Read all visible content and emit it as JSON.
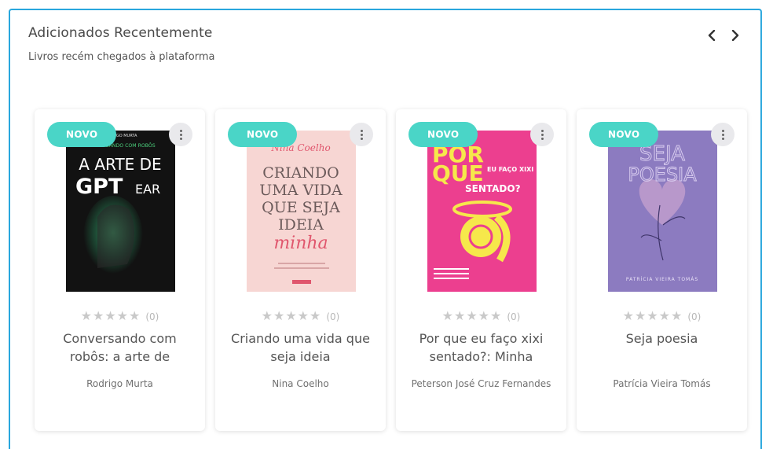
{
  "section": {
    "title": "Adicionados Recentemente",
    "subtitle": "Livros recém chegados à plataforma",
    "prev_icon": "chevron-left-icon",
    "next_icon": "chevron-right-icon"
  },
  "colors": {
    "accent_border": "#29a7dd",
    "badge": "#4ad5c7"
  },
  "books": [
    {
      "badge": "NOVO",
      "stars": "★★★★★",
      "rating_count": "(0)",
      "title": "Conversando com robôs: a arte de",
      "author": "Rodrigo Murta",
      "cover": {
        "top_text": "CONVERSANDO COM ROBÔS",
        "line1": "A ARTE DE",
        "line2": "GPT",
        "line3": "EAR",
        "author_line": "RODRIGO MURTA"
      }
    },
    {
      "badge": "NOVO",
      "stars": "★★★★★",
      "rating_count": "(0)",
      "title": "Criando uma vida que seja ideia",
      "author": "Nina Coelho",
      "cover": {
        "author_line": "Nina Coelho",
        "line1": "CRIANDO",
        "line2": "UMA VIDA",
        "line3": "QUE SEJA",
        "line4": "IDEIA",
        "line5": "minha"
      }
    },
    {
      "badge": "NOVO",
      "stars": "★★★★★",
      "rating_count": "(0)",
      "title": "Por que eu faço xixi sentado?: Minha",
      "author": "Peterson José Cruz Fernandes",
      "cover": {
        "line1": "POR",
        "line2": "QUE",
        "line3": "EU FAÇO XIXI",
        "line4": "SENTADO?"
      }
    },
    {
      "badge": "NOVO",
      "stars": "★★★★★",
      "rating_count": "(0)",
      "title": "Seja poesia",
      "author": "Patrícia Vieira Tomás",
      "cover": {
        "line1": "SEJA",
        "line2": "POESIA",
        "author_line": "PATRÍCIA VIEIRA TOMÁS"
      }
    }
  ]
}
